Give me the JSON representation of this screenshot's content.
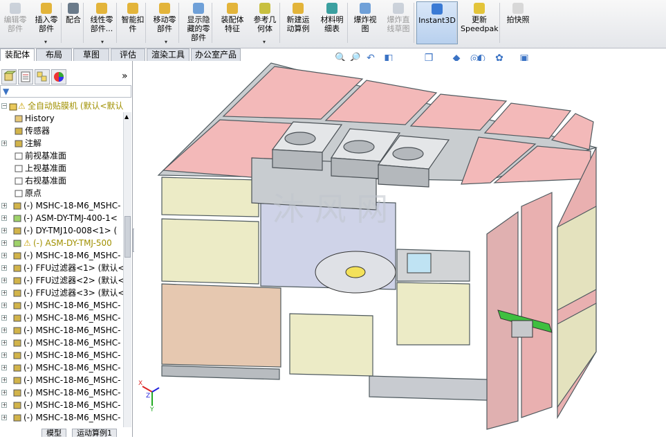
{
  "ribbon": {
    "buttons": [
      {
        "label": "编辑零\n部件",
        "icon": "edit-component-icon",
        "disabled": true
      },
      {
        "label": "插入零\n部件",
        "icon": "insert-component-icon"
      },
      {
        "label": "配合",
        "icon": "mate-icon"
      },
      {
        "label": "线性零\n部件...",
        "icon": "linear-pattern-icon"
      },
      {
        "label": "智能扣\n件",
        "icon": "smart-fasteners-icon"
      },
      {
        "label": "移动零\n部件",
        "icon": "move-component-icon"
      },
      {
        "label": "显示隐\n藏的零\n部件",
        "icon": "show-hidden-icon"
      },
      {
        "label": "装配体\n特征",
        "icon": "assembly-feature-icon"
      },
      {
        "label": "参考几\n何体",
        "icon": "reference-geometry-icon"
      },
      {
        "label": "新建运\n动算例",
        "icon": "new-motion-study-icon"
      },
      {
        "label": "材料明\n细表",
        "icon": "bom-icon"
      },
      {
        "label": "爆炸视\n图",
        "icon": "exploded-view-icon"
      },
      {
        "label": "爆炸直\n线草图",
        "icon": "explode-line-sketch-icon",
        "disabled": true
      },
      {
        "label": "Instant3D",
        "icon": "instant3d-icon",
        "active": true
      },
      {
        "label": "更新\nSpeedpak",
        "icon": "update-speedpak-icon"
      },
      {
        "label": "拍快照",
        "icon": "snapshot-icon"
      }
    ]
  },
  "tabs": [
    "装配体",
    "布局",
    "草图",
    "评估",
    "渲染工具",
    "办公室产品"
  ],
  "feature_tree": {
    "root": "全自动贴膜机 (默认<默认",
    "items": [
      {
        "label": "History",
        "icon": "history-icon",
        "expand": false
      },
      {
        "label": "传感器",
        "icon": "sensor-icon",
        "expand": false
      },
      {
        "label": "注解",
        "icon": "annotation-icon",
        "expand": true
      },
      {
        "label": "前视基准面",
        "icon": "plane-icon",
        "expand": false
      },
      {
        "label": "上视基准面",
        "icon": "plane-icon",
        "expand": false
      },
      {
        "label": "右视基准面",
        "icon": "plane-icon",
        "expand": false
      },
      {
        "label": "原点",
        "icon": "origin-icon",
        "expand": false
      },
      {
        "label": "(-) MSHC-18-M6_MSHC-",
        "icon": "part-icon",
        "expand": true
      },
      {
        "label": "(-) ASM-DY-TMJ-400-1<",
        "icon": "assembly-icon",
        "expand": true
      },
      {
        "label": "(-) DY-TMJ10-008<1> (",
        "icon": "part-icon",
        "expand": true
      },
      {
        "label": "(-) ASM-DY-TMJ-500",
        "icon": "assembly-warning-icon",
        "expand": true,
        "warn": true
      },
      {
        "label": "(-) MSHC-18-M6_MSHC-",
        "icon": "part-icon",
        "expand": true
      },
      {
        "label": "(-) FFU过滤器<1> (默认<",
        "icon": "part-icon",
        "expand": true
      },
      {
        "label": "(-) FFU过滤器<2> (默认<",
        "icon": "part-icon",
        "expand": true
      },
      {
        "label": "(-) FFU过滤器<3> (默认<",
        "icon": "part-icon",
        "expand": true
      },
      {
        "label": "(-) MSHC-18-M6_MSHC-",
        "icon": "part-icon",
        "expand": true
      },
      {
        "label": "(-) MSHC-18-M6_MSHC-",
        "icon": "part-icon",
        "expand": true
      },
      {
        "label": "(-) MSHC-18-M6_MSHC-",
        "icon": "part-icon",
        "expand": true
      },
      {
        "label": "(-) MSHC-18-M6_MSHC-",
        "icon": "part-icon",
        "expand": true
      },
      {
        "label": "(-) MSHC-18-M6_MSHC-",
        "icon": "part-icon",
        "expand": true
      },
      {
        "label": "(-) MSHC-18-M6_MSHC-",
        "icon": "part-icon",
        "expand": true
      },
      {
        "label": "(-) MSHC-18-M6_MSHC-",
        "icon": "part-icon",
        "expand": true
      },
      {
        "label": "(-) MSHC-18-M6_MSHC-",
        "icon": "part-icon",
        "expand": true
      },
      {
        "label": "(-) MSHC-18-M6_MSHC-",
        "icon": "part-icon",
        "expand": true
      },
      {
        "label": "(-) MSHC-18-M6_MSHC-",
        "icon": "part-icon",
        "expand": true
      }
    ]
  },
  "bottom_tabs": [
    "模型",
    "运动算例1"
  ],
  "watermark": "沐 风 网",
  "triad": {
    "x": "X",
    "y": "Y",
    "z": "Z"
  },
  "hud_icons": [
    "zoom-to-fit-icon",
    "zoom-area-icon",
    "previous-view-icon",
    "section-view-icon",
    "view-orientation-icon",
    "display-style-icon",
    "hide-show-icon",
    "edit-appearance-icon",
    "apply-scene-icon",
    "view-settings-icon"
  ],
  "colors": {
    "accent": "#3b73c4",
    "panel_pink": "#f3b9b9",
    "panel_cream": "#ecebc6",
    "frame": "#5f6a6f"
  }
}
